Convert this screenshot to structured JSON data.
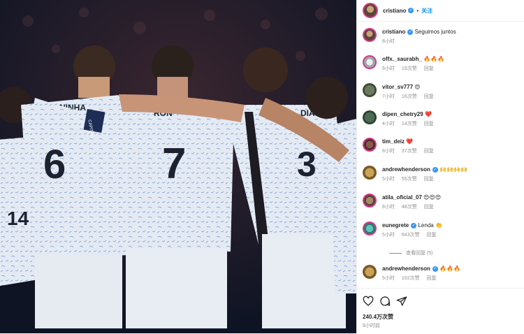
{
  "post": {
    "author": "cristiano",
    "follow_label": "关注",
    "dot": "•",
    "caption": "Seguimos juntos",
    "caption_time": "8小时",
    "likes": "240.4万次赞",
    "posted_ago": "8小时前"
  },
  "photo": {
    "jersey_numbers": [
      "6",
      "7",
      "3",
      "14"
    ],
    "jersey_names": [
      "NINHA",
      "RON",
      "DIAS"
    ],
    "armband": "CAPITÃO"
  },
  "comments": [
    {
      "user": "offx._saurabh_",
      "verified": false,
      "text": "🔥🔥🔥",
      "time": "6小时",
      "likes": "19次赞",
      "reply": "回复"
    },
    {
      "user": "vitor_sv777",
      "verified": false,
      "text": "😍",
      "time": "7小时",
      "likes": "16次赞",
      "reply": "回复"
    },
    {
      "user": "dipen_chetry29",
      "verified": false,
      "text": "❤️",
      "time": "4小时",
      "likes": "14次赞",
      "reply": "回复"
    },
    {
      "user": "tim_deiz",
      "verified": false,
      "text": "❤️",
      "time": "8小时",
      "likes": "37次赞",
      "reply": "回复"
    },
    {
      "user": "andrewhenderson",
      "verified": true,
      "text": "🙌🙌🙌🙌",
      "time": "5小时",
      "likes": "55次赞",
      "reply": "回复"
    },
    {
      "user": "atila_oficial_07",
      "verified": false,
      "text": "😍😍😍",
      "time": "8小时",
      "likes": "48次赞",
      "reply": "回复"
    },
    {
      "user": "eunegrete",
      "verified": true,
      "text": "Lenda 👏",
      "time": "5小时",
      "likes": "643次赞",
      "reply": "回复"
    },
    {
      "user": "andrewhenderson",
      "verified": true,
      "text": "🔥🔥🔥",
      "time": "5小时",
      "likes": "102次赞",
      "reply": "回复"
    }
  ],
  "view_replies": "查看回复 (5)",
  "icons": [
    "heart-icon",
    "comment-icon",
    "share-icon",
    "bookmark-icon",
    "verified-icon"
  ],
  "colors": {
    "follow": "#0095f6",
    "verified": "#3897f0",
    "muted": "#8e8e8e",
    "ring": "#d63b8f"
  }
}
